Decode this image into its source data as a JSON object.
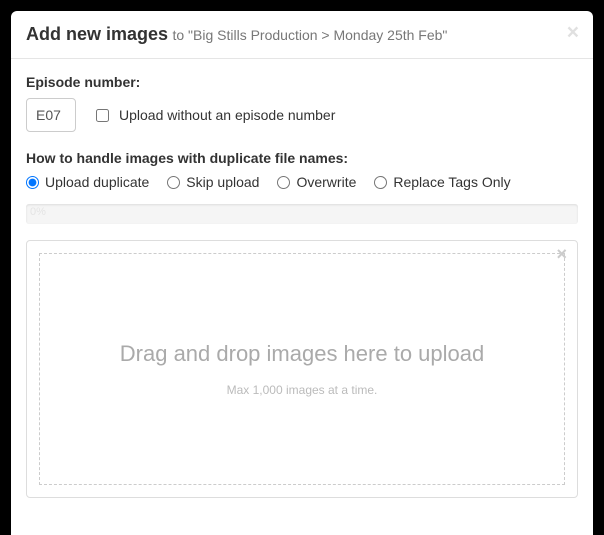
{
  "header": {
    "title": "Add new images",
    "subtitle": "to \"Big Stills Production > Monday 25th Feb\""
  },
  "episode": {
    "label": "Episode number:",
    "value": "E07",
    "checkbox_label": "Upload without an episode number"
  },
  "duplicate": {
    "label": "How to handle images with duplicate file names:",
    "options": {
      "upload": "Upload duplicate",
      "skip": "Skip upload",
      "overwrite": "Overwrite",
      "replace": "Replace Tags Only"
    }
  },
  "progress": {
    "text": "0%"
  },
  "dropzone": {
    "main": "Drag and drop images here to upload",
    "sub": "Max 1,000 images at a time."
  }
}
